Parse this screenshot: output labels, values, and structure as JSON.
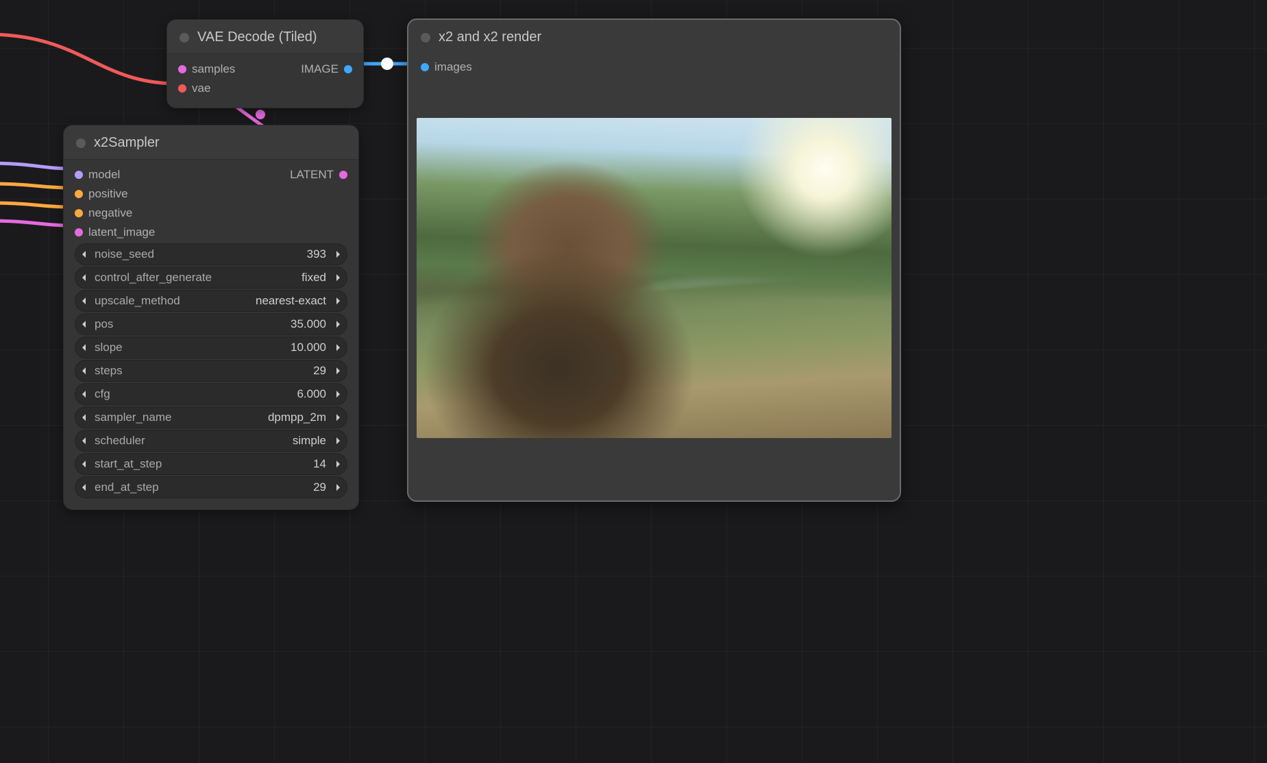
{
  "nodes": {
    "vae_decode": {
      "title": "VAE Decode (Tiled)",
      "inputs": {
        "samples": "samples",
        "vae": "vae"
      },
      "outputs": {
        "image": "IMAGE"
      }
    },
    "x2sampler": {
      "title": "x2Sampler",
      "inputs": {
        "model": "model",
        "positive": "positive",
        "negative": "negative",
        "latent_image": "latent_image"
      },
      "outputs": {
        "latent": "LATENT"
      },
      "params": [
        {
          "name": "noise_seed",
          "value": "393"
        },
        {
          "name": "control_after_generate",
          "value": "fixed"
        },
        {
          "name": "upscale_method",
          "value": "nearest-exact"
        },
        {
          "name": "pos",
          "value": "35.000"
        },
        {
          "name": "slope",
          "value": "10.000"
        },
        {
          "name": "steps",
          "value": "29"
        },
        {
          "name": "cfg",
          "value": "6.000"
        },
        {
          "name": "sampler_name",
          "value": "dpmpp_2m"
        },
        {
          "name": "scheduler",
          "value": "simple"
        },
        {
          "name": "start_at_step",
          "value": "14"
        },
        {
          "name": "end_at_step",
          "value": "29"
        }
      ]
    },
    "preview": {
      "title": "x2 and x2 render",
      "inputs": {
        "images": "images"
      }
    }
  },
  "port_colors": {
    "samples": "#e66adf",
    "vae": "#f15a5a",
    "image": "#3fa8ff",
    "images": "#3fa8ff",
    "model": "#b49cff",
    "positive": "#ffa83f",
    "negative": "#ffa83f",
    "latent_image": "#e66adf",
    "latent": "#e66adf"
  }
}
